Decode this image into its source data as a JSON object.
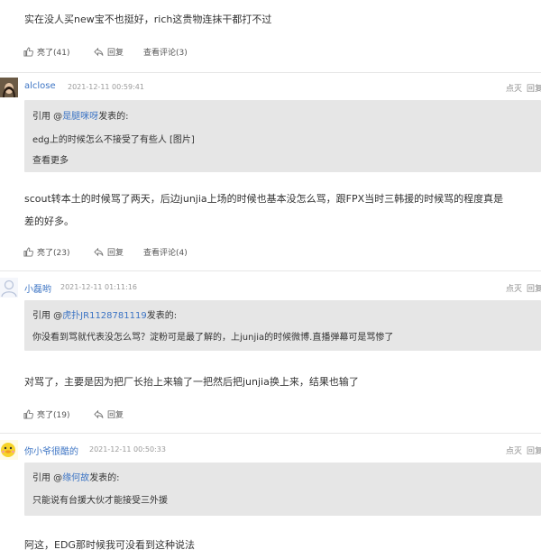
{
  "comments": [
    {
      "body": [
        "实在没人买new宝不也挺好，rich这贵物连抹干都打不过"
      ],
      "like_label": "亮了(41)",
      "reply_label": "回复",
      "view_replies_label": "查看评论(3)"
    },
    {
      "username": "alclose",
      "timestamp": "2021-12-11 00:59:41",
      "quote_prefix": "引用 @",
      "quote_user": "是腿咪呀",
      "quote_suffix": "发表的:",
      "quote_text": "edg上的时候怎么不接受了有些人 [图片]",
      "see_more_label": "查看更多",
      "body": [
        "scout转本土的时候骂了两天，后边junjia上场的时候也基本没怎么骂，跟FPX当时三韩援的时候骂的程度真是",
        "差的好多。"
      ],
      "like_label": "亮了(23)",
      "reply_label": "回复",
      "view_replies_label": "查看评论(4)",
      "report_label": "点灭",
      "reply_right_label": "回复"
    },
    {
      "username": "小磊哟",
      "timestamp": "2021-12-11 01:11:16",
      "quote_prefix": "引用 @",
      "quote_user": "虎扑JR1128781119",
      "quote_suffix": "发表的:",
      "quote_text": "你没看到骂就代表没怎么骂？淀粉可是最了解的，上junjia的时候微博.直播弹幕可是骂惨了",
      "body": [
        "对骂了，主要是因为把厂长抬上来输了一把然后把junjia换上来，结果也输了"
      ],
      "like_label": "亮了(19)",
      "reply_label": "回复",
      "report_label": "点灭",
      "reply_right_label": "回复"
    },
    {
      "username": "你小爷很酷的",
      "timestamp": "2021-12-11 00:50:33",
      "quote_prefix": "引用 @",
      "quote_user": "缘何故",
      "quote_suffix": "发表的:",
      "quote_text": "只能说有台援大伙才能接受三外援",
      "body": [
        "阿这，EDG那时候我可没看到这种说法"
      ],
      "report_label": "点灭",
      "reply_right_label": "回复"
    }
  ],
  "icons": {
    "like": "thumbs-up-icon",
    "reply": "reply-icon",
    "view": "comment-icon"
  }
}
